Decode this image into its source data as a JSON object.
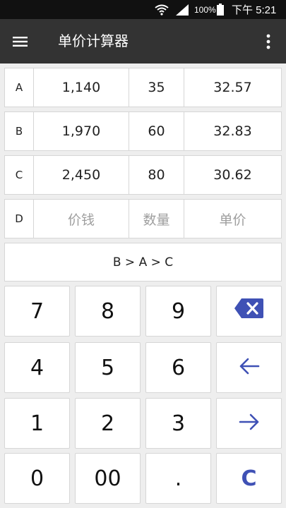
{
  "status_bar": {
    "battery_text": "100%",
    "time": "下午 5:21",
    "icons": [
      "wifi-icon",
      "signal-icon",
      "battery-icon"
    ]
  },
  "app_bar": {
    "title": "单价计算器",
    "icons": [
      "menu-icon",
      "overflow-menu-icon"
    ]
  },
  "rows": [
    {
      "label": "A",
      "price": "1,140",
      "quantity": "35",
      "unit_price": "32.57"
    },
    {
      "label": "B",
      "price": "1,970",
      "quantity": "60",
      "unit_price": "32.83"
    },
    {
      "label": "C",
      "price": "2,450",
      "quantity": "80",
      "unit_price": "30.62"
    },
    {
      "label": "D",
      "price_placeholder": "价钱",
      "quantity_placeholder": "数量",
      "unit_price_placeholder": "单价"
    }
  ],
  "result": "B > A > C",
  "keypad": {
    "keys": [
      "7",
      "8",
      "9",
      "4",
      "5",
      "6",
      "1",
      "2",
      "3",
      "0",
      "00",
      ".",
      "C"
    ],
    "icons": [
      "backspace-icon",
      "arrow-left-icon",
      "arrow-right-icon"
    ]
  },
  "colors": {
    "status_bar": "#111111",
    "app_bar": "#333333",
    "background": "#eeeeee",
    "accent": "#3f51b5",
    "placeholder": "#9e9e9e"
  }
}
